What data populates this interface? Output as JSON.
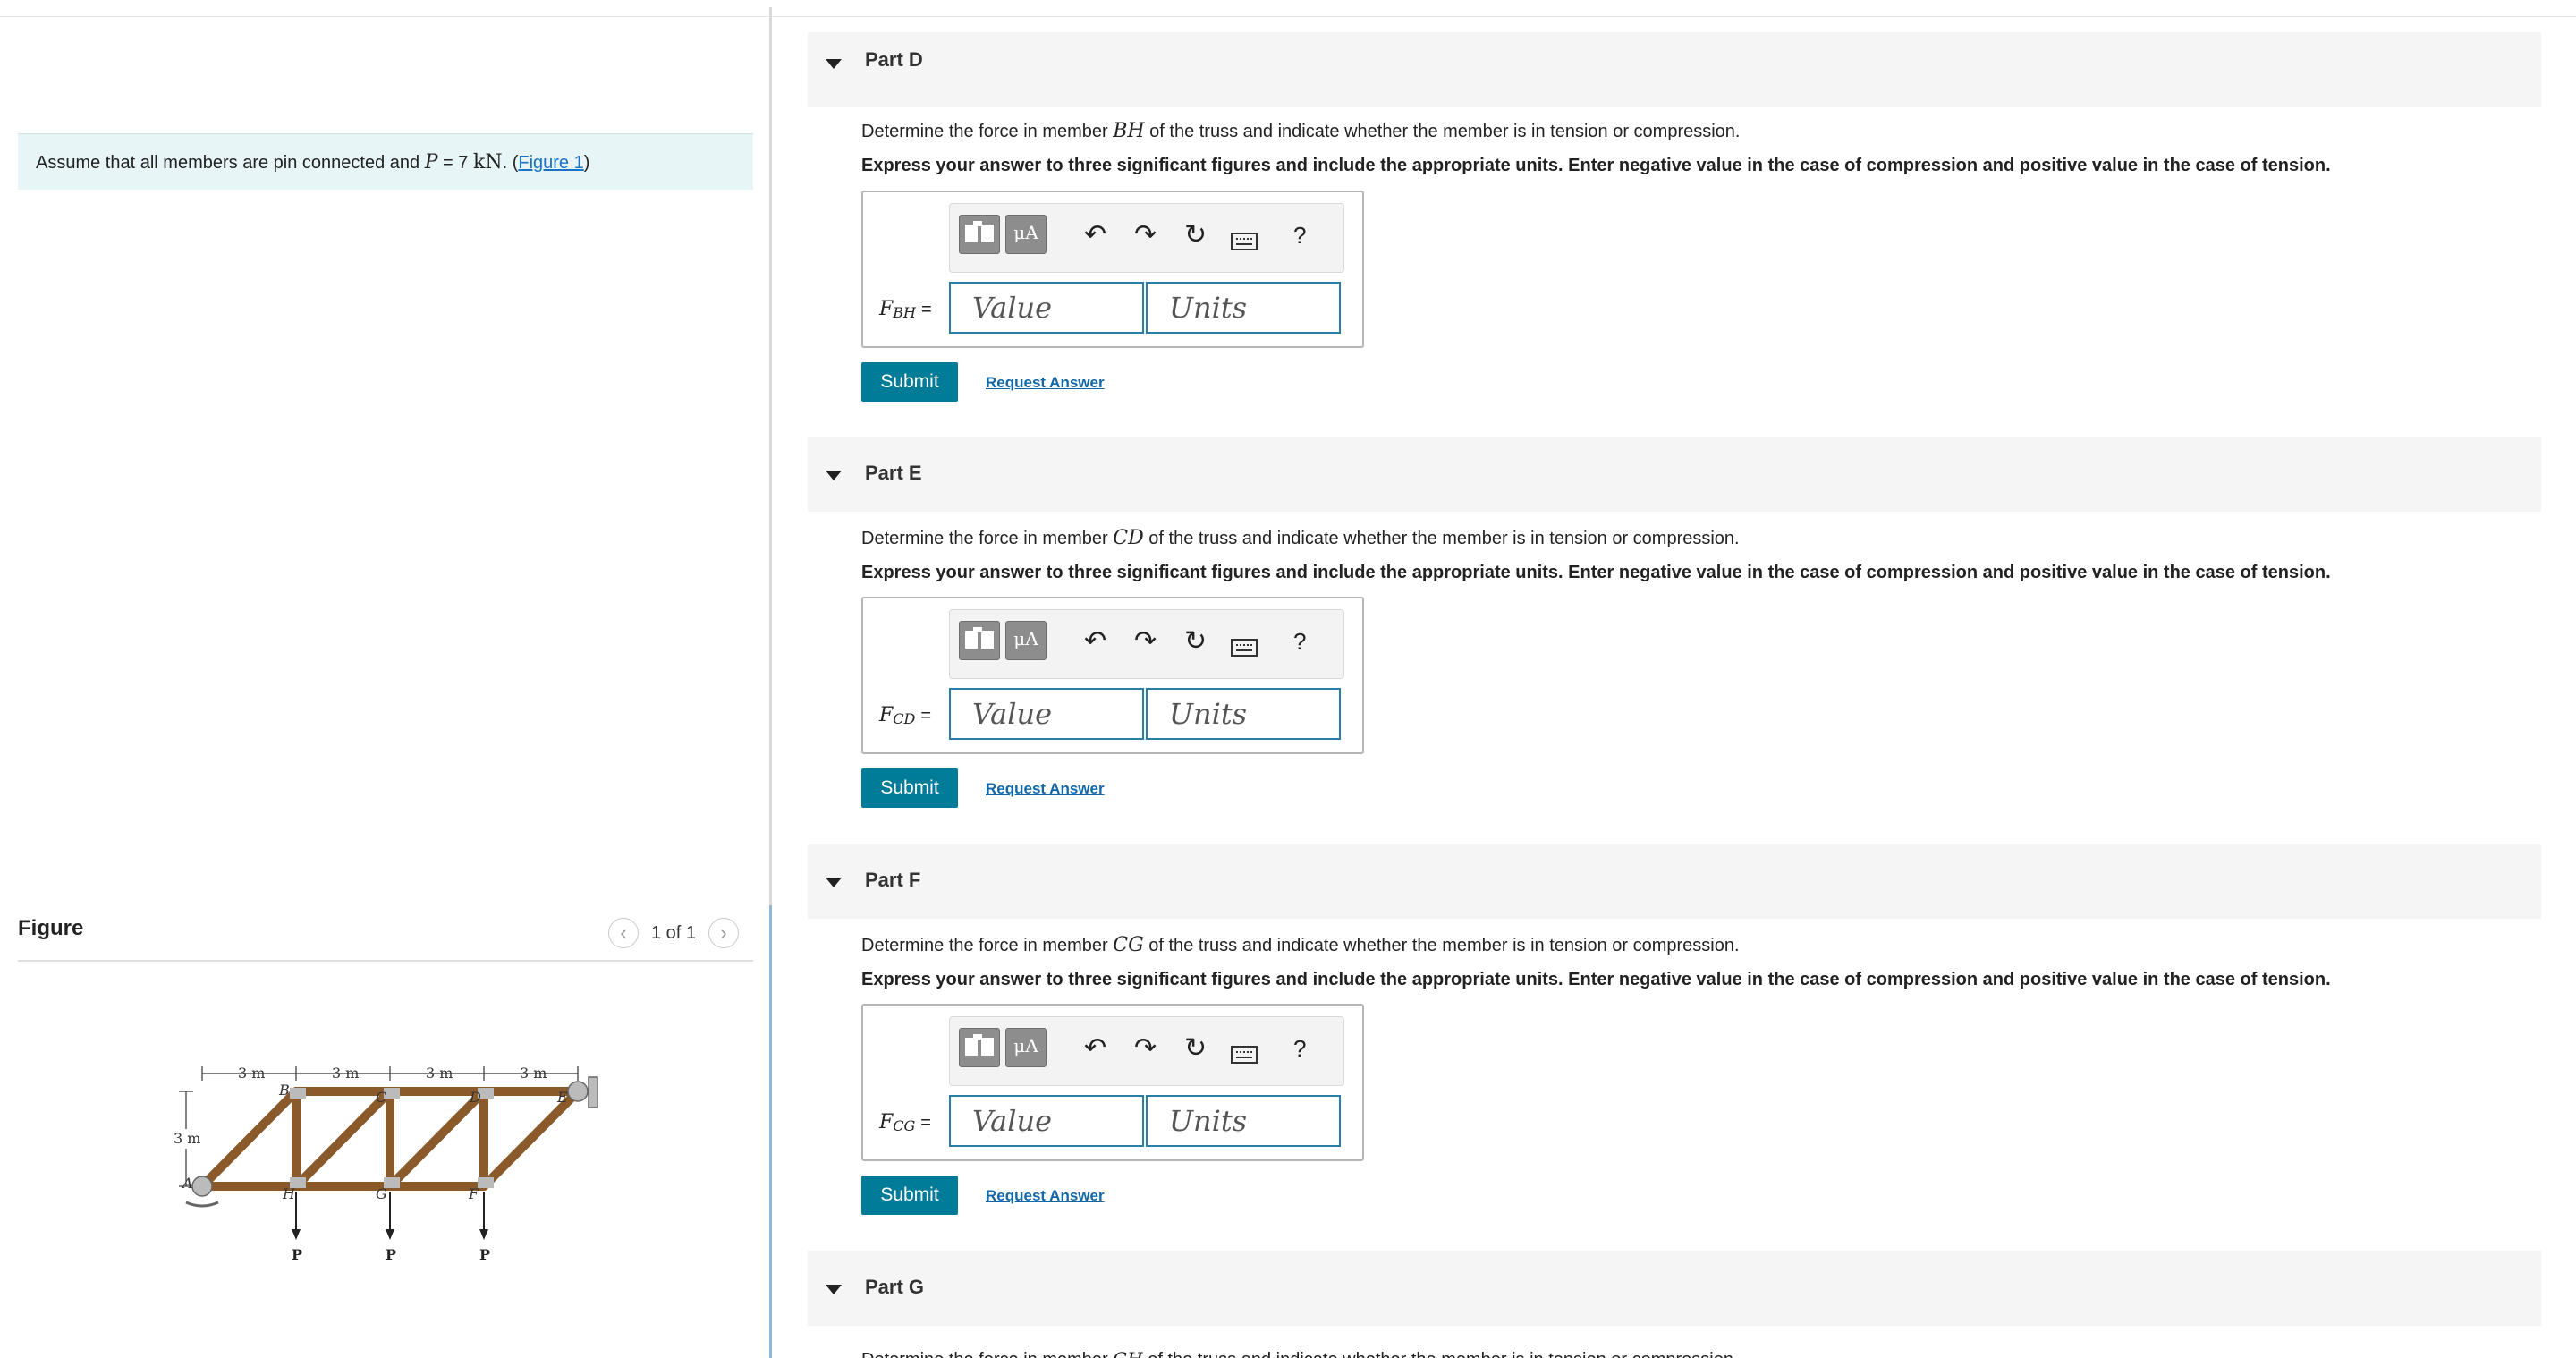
{
  "left": {
    "assume_text": "Assume that all members are pin connected and",
    "assume_math": "P",
    "assume_eq": " = 7 ",
    "assume_unit": "kN",
    "assume_period": ". (",
    "figure_link": "Figure 1",
    "assume_close": ")",
    "figure_title": "Figure",
    "figure_count": "1 of 1",
    "figure_labels": {
      "dims": [
        "3 m",
        "3 m",
        "3 m",
        "3 m"
      ],
      "height": "3 m",
      "top_joints": [
        "B",
        "C",
        "D",
        "E"
      ],
      "bottom_joints": [
        "A",
        "H",
        "G",
        "F"
      ],
      "loads": [
        "P",
        "P",
        "P"
      ]
    }
  },
  "parts": [
    {
      "header": "Part D",
      "question_pre": "Determine the force in member",
      "member": "BH",
      "question_post": "of the truss and indicate whether the member is in tension or compression.",
      "instruction": "Express your answer to three significant figures and include the appropriate units. Enter negative value in the case of compression and positive value in the case of tension.",
      "var": "F",
      "var_sub": "BH",
      "value_placeholder": "Value",
      "units_placeholder": "Units",
      "submit": "Submit",
      "request": "Request Answer"
    },
    {
      "header": "Part E",
      "question_pre": "Determine the force in member",
      "member": "CD",
      "question_post": "of the truss and indicate whether the member is in tension or compression.",
      "instruction": "Express your answer to three significant figures and include the appropriate units. Enter negative value in the case of compression and positive value in the case of tension.",
      "var": "F",
      "var_sub": "CD",
      "value_placeholder": "Value",
      "units_placeholder": "Units",
      "submit": "Submit",
      "request": "Request Answer"
    },
    {
      "header": "Part F",
      "question_pre": "Determine the force in member",
      "member": "CG",
      "question_post": "of the truss and indicate whether the member is in tension or compression.",
      "instruction": "Express your answer to three significant figures and include the appropriate units. Enter negative value in the case of compression and positive value in the case of tension.",
      "var": "F",
      "var_sub": "CG",
      "value_placeholder": "Value",
      "units_placeholder": "Units",
      "submit": "Submit",
      "request": "Request Answer"
    },
    {
      "header": "Part G",
      "question_pre": "Determine the force in member",
      "member": "GH",
      "question_post": "of the truss and indicate whether the member is in tension or compression."
    }
  ],
  "toolbar": {
    "mu_label": "μA",
    "help_label": "?"
  },
  "colors": {
    "accent": "#007c99",
    "field_border": "#2a7fa8",
    "link": "#1167a8",
    "assume_bg": "#e8f5f6"
  }
}
